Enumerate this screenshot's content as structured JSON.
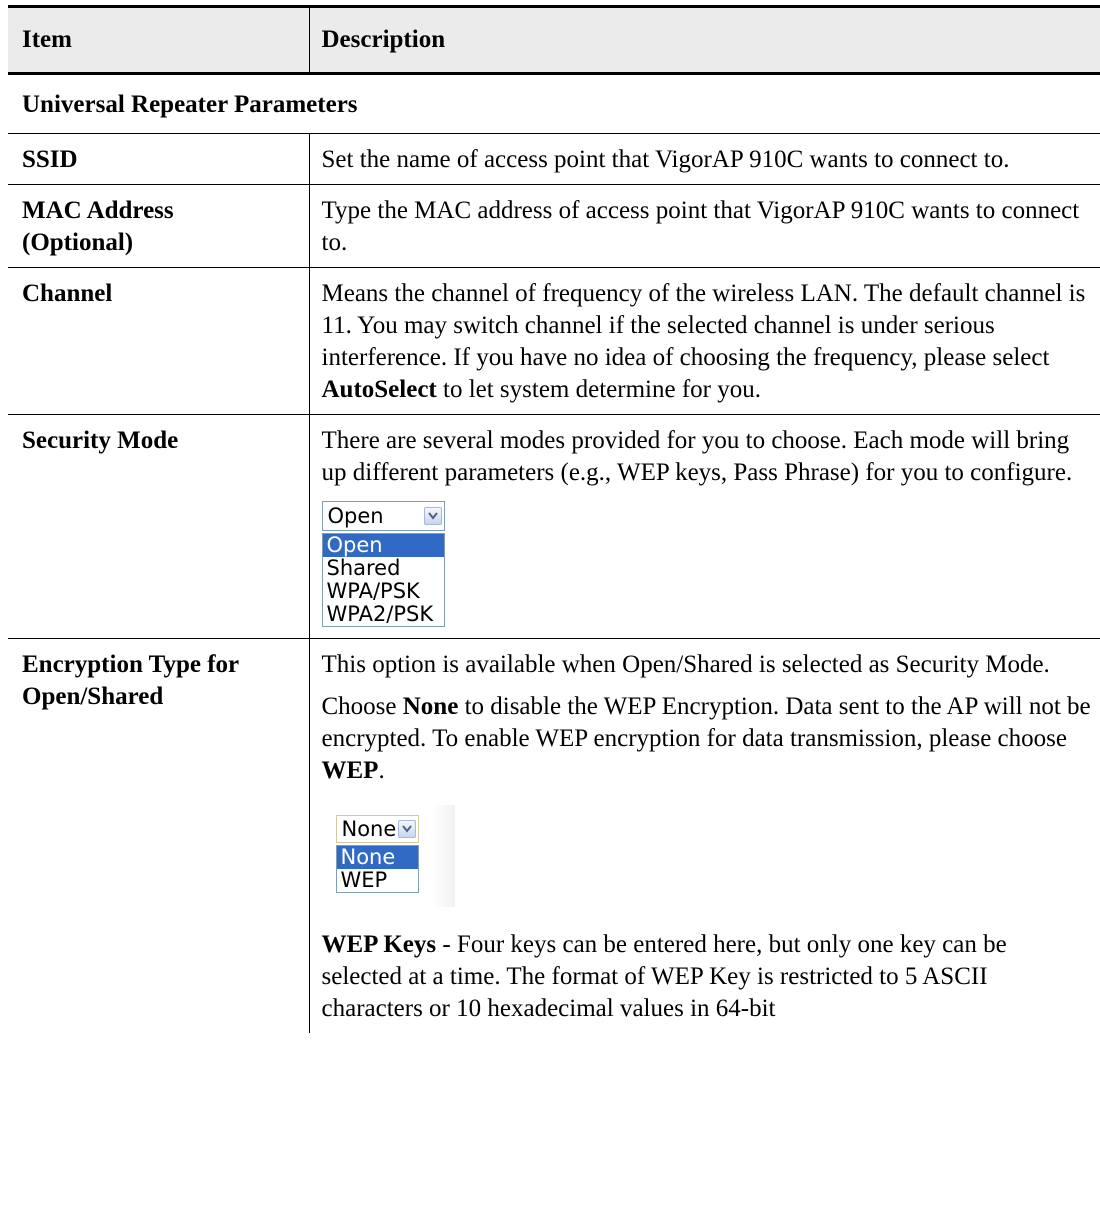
{
  "table": {
    "headers": {
      "item": "Item",
      "description": "Description"
    },
    "section_title": "Universal Repeater Parameters",
    "rows": {
      "ssid": {
        "item": "SSID",
        "description": "Set the name of access point that VigorAP 910C wants to connect to."
      },
      "mac": {
        "item_line1": "MAC Address",
        "item_line2": "(Optional)",
        "description": "Type the MAC address of access point that VigorAP 910C wants to connect to."
      },
      "channel": {
        "item": "Channel",
        "description_pre": "Means the channel of frequency of the wireless LAN. The default channel is 11. You may switch channel if the selected channel is under serious interference. If you have no idea of choosing the frequency, please select ",
        "description_bold": "AutoSelect",
        "description_post": " to let system determine for you."
      },
      "security_mode": {
        "item": "Security Mode",
        "description": "There are several modes provided for you to choose. Each mode will bring up different parameters (e.g., WEP keys, Pass Phrase) for you to configure.",
        "dropdown": {
          "selected": "Open",
          "options": [
            "Open",
            "Shared",
            "WPA/PSK",
            "WPA2/PSK"
          ]
        }
      },
      "encryption": {
        "item_line1": "Encryption Type for",
        "item_line2": "Open/Shared",
        "para1": "This option is available when Open/Shared is selected as Security Mode.",
        "para2_pre": "Choose ",
        "para2_bold1": "None",
        "para2_mid": " to disable the WEP Encryption. Data sent to the AP will not be encrypted. To enable WEP encryption for data transmission, please choose ",
        "para2_bold2": "WEP",
        "para2_post": ".",
        "dropdown": {
          "selected": "None",
          "options": [
            "None",
            "WEP"
          ]
        },
        "para3_bold": "WEP Keys",
        "para3_text": " - Four keys can be entered here, but only one key can be selected at a time. The format of WEP Key is restricted to 5 ASCII characters or 10 hexadecimal values in 64-bit"
      }
    }
  },
  "colors": {
    "selected_option_bg": "#316ac5",
    "header_bg": "#ebebeb",
    "dropdown_border": "#7f9db9"
  },
  "icons": {
    "dropdown_arrow": "chevron-down-icon"
  }
}
